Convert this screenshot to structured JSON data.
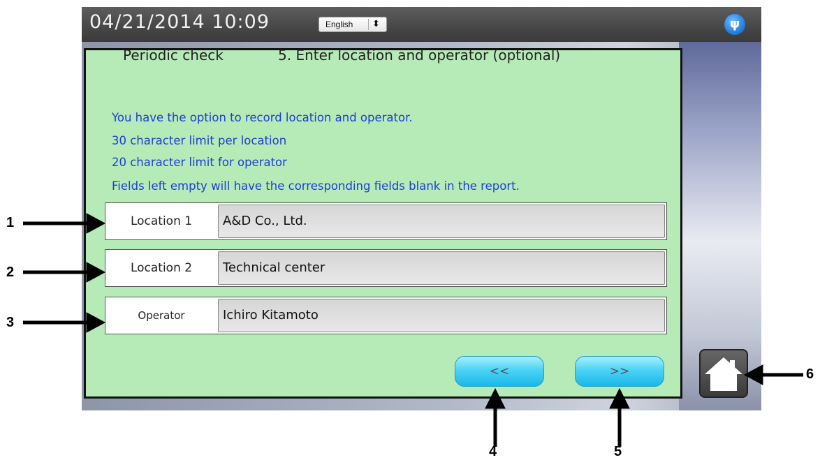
{
  "header": {
    "datetime": "04/21/2014  10:09",
    "language": "English",
    "icons": {
      "usb": "usb-icon",
      "language_arrow": "up-down-arrow-icon"
    }
  },
  "panel": {
    "left_title": "Periodic check",
    "step_title": "5. Enter location and operator (optional)",
    "info_lines": [
      "You have the option to record location and operator.",
      "30 character limit per location",
      "20 character limit for operator",
      "Fields left empty will have the corresponding fields blank in the report."
    ],
    "fields": [
      {
        "label": "Location 1",
        "value": "A&D Co., Ltd."
      },
      {
        "label": "Location 2",
        "value": "Technical center"
      },
      {
        "label": "Operator",
        "value": "Ichiro Kitamoto"
      }
    ],
    "back_label": "<<",
    "next_label": ">>"
  },
  "home": {
    "icon": "home-icon"
  },
  "callouts": [
    "1",
    "2",
    "3",
    "4",
    "5",
    "6"
  ],
  "colors": {
    "panel_bg": "#b6ebb8",
    "info_text": "#1c3fd0",
    "button": "#4cd3f5",
    "titlebar": "#4a4a4a"
  }
}
